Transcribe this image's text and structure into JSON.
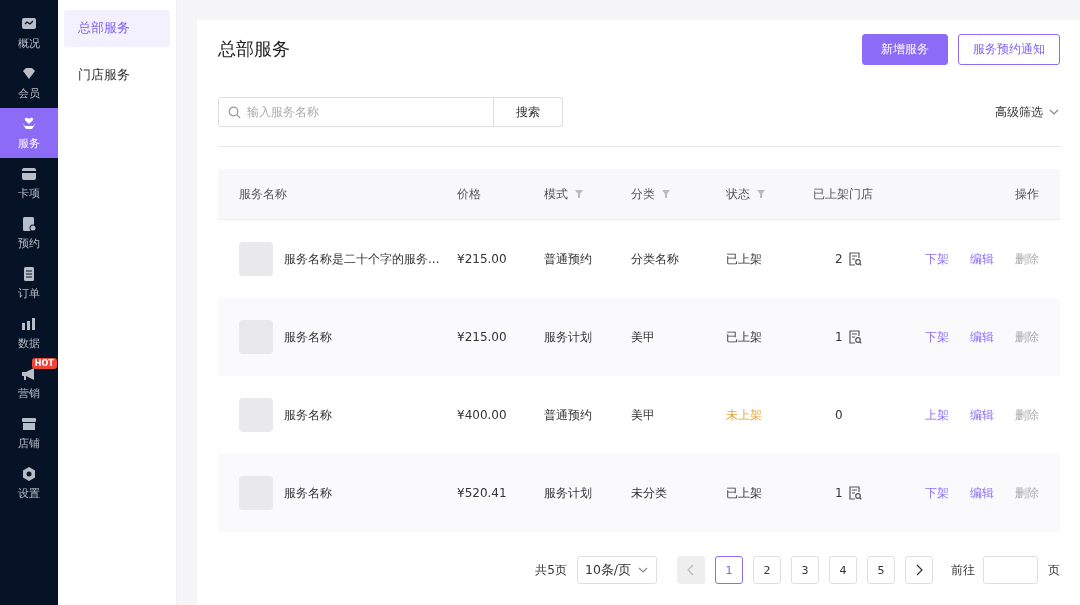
{
  "nav": [
    {
      "label": "概况",
      "selected": false
    },
    {
      "label": "会员",
      "selected": false
    },
    {
      "label": "服务",
      "selected": true
    },
    {
      "label": "卡项",
      "selected": false
    },
    {
      "label": "预约",
      "selected": false
    },
    {
      "label": "订单",
      "selected": false
    },
    {
      "label": "数据",
      "selected": false
    },
    {
      "label": "营销",
      "selected": false,
      "badge": "HOT"
    },
    {
      "label": "店铺",
      "selected": false
    },
    {
      "label": "设置",
      "selected": false
    }
  ],
  "subnav": [
    {
      "label": "总部服务",
      "selected": true
    },
    {
      "label": "门店服务",
      "selected": false
    }
  ],
  "page": {
    "title": "总部服务",
    "buttons": [
      {
        "label": "新增服务",
        "kind": "primary"
      },
      {
        "label": "服务预约通知",
        "kind": "outline"
      }
    ]
  },
  "search": {
    "placeholder": "输入服务名称",
    "button": "搜索",
    "advanced_filter": "高级筛选"
  },
  "table": {
    "columns": [
      {
        "label": "服务名称",
        "filter": false
      },
      {
        "label": "价格",
        "filter": false
      },
      {
        "label": "模式",
        "filter": true
      },
      {
        "label": "分类",
        "filter": true
      },
      {
        "label": "状态",
        "filter": true
      },
      {
        "label": "已上架门店",
        "filter": false
      },
      {
        "label": "操作",
        "filter": false
      }
    ],
    "rows": [
      {
        "name": "服务名称是二十个字的服务...",
        "price": "¥215.00",
        "mode": "普通预约",
        "category": "分类名称",
        "status": "已上架",
        "pending": false,
        "stores": "2",
        "store_icon": true,
        "actions": [
          "下架",
          "编辑",
          "删除"
        ]
      },
      {
        "name": "服务名称",
        "price": "¥215.00",
        "mode": "服务计划",
        "category": "美甲",
        "status": "已上架",
        "pending": false,
        "stores": "1",
        "store_icon": true,
        "actions": [
          "下架",
          "编辑",
          "删除"
        ]
      },
      {
        "name": "服务名称",
        "price": "¥400.00",
        "mode": "普通预约",
        "category": "美甲",
        "status": "未上架",
        "pending": true,
        "stores": "0",
        "store_icon": false,
        "actions": [
          "上架",
          "编辑",
          "删除"
        ]
      },
      {
        "name": "服务名称",
        "price": "¥520.41",
        "mode": "服务计划",
        "category": "未分类",
        "status": "已上架",
        "pending": false,
        "stores": "1",
        "store_icon": true,
        "actions": [
          "下架",
          "编辑",
          "删除"
        ]
      }
    ]
  },
  "pagination": {
    "total": "共5页",
    "page_size": "10条/页",
    "prev_disabled": true,
    "pages": [
      {
        "label": "1",
        "selected": true
      },
      {
        "label": "2",
        "selected": false
      },
      {
        "label": "3",
        "selected": false
      },
      {
        "label": "4",
        "selected": false
      },
      {
        "label": "5",
        "selected": false
      }
    ],
    "goto_label": "前往",
    "goto_suffix": "页"
  }
}
